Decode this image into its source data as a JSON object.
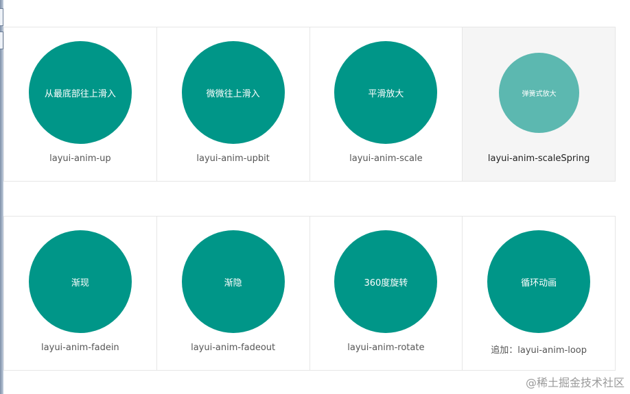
{
  "row1": [
    {
      "text": "从最底部往上滑入",
      "label": "layui-anim-up"
    },
    {
      "text": "微微往上滑入",
      "label": "layui-anim-upbit"
    },
    {
      "text": "平滑放大",
      "label": "layui-anim-scale"
    },
    {
      "text": "弹簧式放大",
      "label": "layui-anim-scaleSpring"
    }
  ],
  "row2": [
    {
      "text": "渐现",
      "label": "layui-anim-fadein"
    },
    {
      "text": "渐隐",
      "label": "layui-anim-fadeout"
    },
    {
      "text": "360度旋转",
      "label": "layui-anim-rotate"
    },
    {
      "text": "循环动画",
      "label": "追加：layui-anim-loop"
    }
  ],
  "watermark": "@稀土掘金技术社区",
  "colors": {
    "accent": "#009688",
    "accent_light": "#5cb8b0",
    "hover_bg": "#f5f5f5",
    "border": "#e6e6e6"
  }
}
